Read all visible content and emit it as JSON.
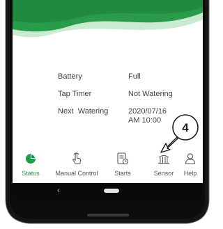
{
  "status": {
    "rows": [
      {
        "label": "Battery",
        "value": "Full"
      },
      {
        "label": "Tap Timer",
        "value": "Not Watering"
      },
      {
        "label": "Next  Watering",
        "value_line1": "2020/07/16",
        "value_line2": "AM 10:00"
      }
    ]
  },
  "tabs": [
    {
      "label": "Status",
      "icon": "pie-chart-icon",
      "active": true
    },
    {
      "label": "Manual Control",
      "icon": "hand-pointer-icon",
      "active": false
    },
    {
      "label": "Starts",
      "icon": "schedule-icon",
      "active": false
    },
    {
      "label": "Sensor",
      "icon": "sensor-icon",
      "active": false
    },
    {
      "label": "Help",
      "icon": "person-icon",
      "active": false
    }
  ],
  "navbar": {
    "back_symbol": "‹"
  },
  "callout": {
    "number": "4"
  },
  "colors": {
    "accent": "#1e9c48",
    "wave_dark": "#2a9a4b",
    "wave_light": "#8fd19b",
    "navbar": "#0a0a0a"
  }
}
